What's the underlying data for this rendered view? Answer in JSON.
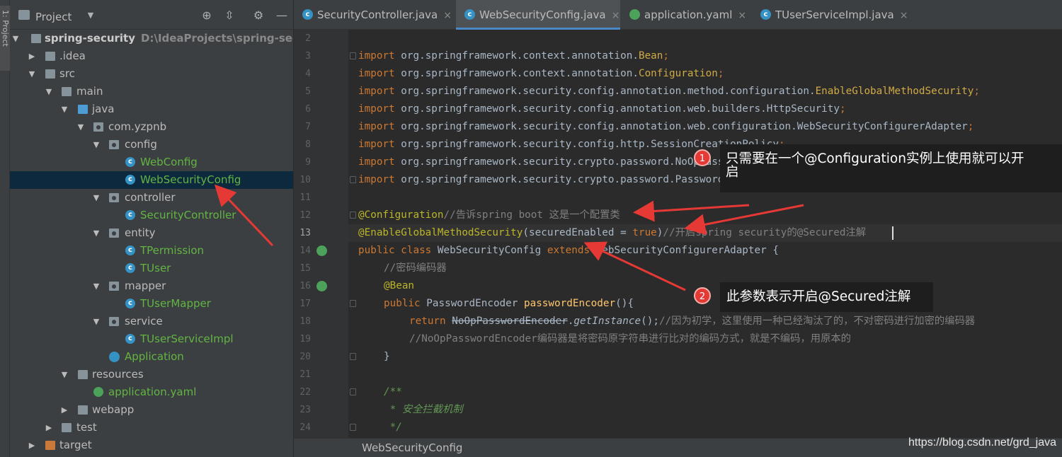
{
  "tool_strip": {
    "project_tab": "1: Project"
  },
  "project_panel": {
    "title": "Project",
    "tree": [
      {
        "label": "spring-security",
        "path": "D:\\IdeaProjects\\spring-securi"
      },
      {
        "label": ".idea"
      },
      {
        "label": "src"
      },
      {
        "label": "main"
      },
      {
        "label": "java"
      },
      {
        "label": "com.yzpnb"
      },
      {
        "label": "config"
      },
      {
        "label": "WebConfig"
      },
      {
        "label": "WebSecurityConfig"
      },
      {
        "label": "controller"
      },
      {
        "label": "SecurityController"
      },
      {
        "label": "entity"
      },
      {
        "label": "TPermission"
      },
      {
        "label": "TUser"
      },
      {
        "label": "mapper"
      },
      {
        "label": "TUserMapper"
      },
      {
        "label": "service"
      },
      {
        "label": "TUserServiceImpl"
      },
      {
        "label": "Application"
      },
      {
        "label": "resources"
      },
      {
        "label": "application.yaml"
      },
      {
        "label": "webapp"
      },
      {
        "label": "test"
      },
      {
        "label": "target"
      }
    ]
  },
  "tabs": [
    {
      "label": "SecurityController.java",
      "active": false
    },
    {
      "label": "WebSecurityConfig.java",
      "active": true
    },
    {
      "label": "application.yaml",
      "active": false
    },
    {
      "label": "TUserServiceImpl.java",
      "active": false
    }
  ],
  "editor": {
    "line_numbers": [
      "2",
      "3",
      "4",
      "5",
      "6",
      "7",
      "8",
      "9",
      "10",
      "11",
      "12",
      "13",
      "14",
      "15",
      "16",
      "17",
      "18",
      "19",
      "20",
      "21",
      "22",
      "23",
      "24"
    ],
    "lines": [
      {
        "k": "",
        "r": ""
      },
      {
        "k": "import",
        "r": " org.springframework.context.annotation.",
        "y": "Bean",
        "e": ";"
      },
      {
        "k": "import",
        "r": " org.springframework.context.annotation.",
        "y": "Configuration",
        "e": ";"
      },
      {
        "k": "import",
        "r": " org.springframework.security.config.annotation.method.configuration.",
        "y": "EnableGlobalMethodSecurity",
        "e": ";"
      },
      {
        "k": "import",
        "r": " org.springframework.security.config.annotation.web.builders.HttpSecurity",
        "y": "",
        "e": ";"
      },
      {
        "k": "import",
        "r": " org.springframework.security.config.annotation.web.configuration.WebSecurityConfigurerAdapter",
        "y": "",
        "e": ";"
      },
      {
        "k": "import",
        "r": " org.springframework.security.config.http.SessionCreationPolicy",
        "y": "",
        "e": ";"
      },
      {
        "k": "import",
        "r": " org.springframework.security.crypto.password.NoOpPasswordEncoder",
        "y": "",
        "e": ";"
      },
      {
        "k": "import",
        "r": " org.springframework.security.crypto.password.PasswordEncoder",
        "y": "",
        "e": ";"
      }
    ],
    "line12_ann": "@Configuration",
    "line12_cmt": "//告诉spring boot 这是一个配置类",
    "line13_ann": "@EnableGlobalMethodSecurity",
    "line13_param": "securedEnabled",
    "line13_eq": " = ",
    "line13_val": "true",
    "line13_cmt": "//开启spring security的@Secured注解",
    "line14_kw": "public class",
    "line14_name": " WebSecurityConfig ",
    "line14_kw2": "extends",
    "line14_rest": " WebSecurityConfigurerAdapter {",
    "line15_cmt": "//密码编码器",
    "line16_ann": "@Bean",
    "line17_kw": "public",
    "line17_type": " PasswordEncoder ",
    "line17_fn": "passwordEncoder",
    "line17_rest": "(){",
    "line18_kw": "return",
    "line18_cls": "NoOpPasswordEncoder",
    "line18_dot": ".",
    "line18_fn": "getInstance",
    "line18_rest": "();",
    "line18_cmt": "//因为初学，这里使用一种已经淘汰了的，不对密码进行加密的编码器",
    "line19_cmt": "//NoOpPasswordEncoder编码器是将密码原字符串进行比对的编码方式，就是不编码，用原本的",
    "line20": "}",
    "line22_doc": "/**",
    "line23_doc": " * 安全拦截机制",
    "line24_doc": " */"
  },
  "breadcrumb": "WebSecurityConfig",
  "callouts": [
    {
      "badge": "1",
      "text_line1": "只需要在一个@Configuration实例上使用就可以开",
      "text_line2": "启"
    },
    {
      "badge": "2",
      "text": "此参数表示开启@Secured注解"
    }
  ],
  "watermark": "https://blog.csdn.net/grd_java",
  "colors": {
    "keyword": "#cc7832",
    "annotation": "#bbb529",
    "comment": "#808080",
    "doc": "#629755",
    "method": "#ffc66d",
    "arrow": "#e53935",
    "selection": "#0d293e"
  }
}
